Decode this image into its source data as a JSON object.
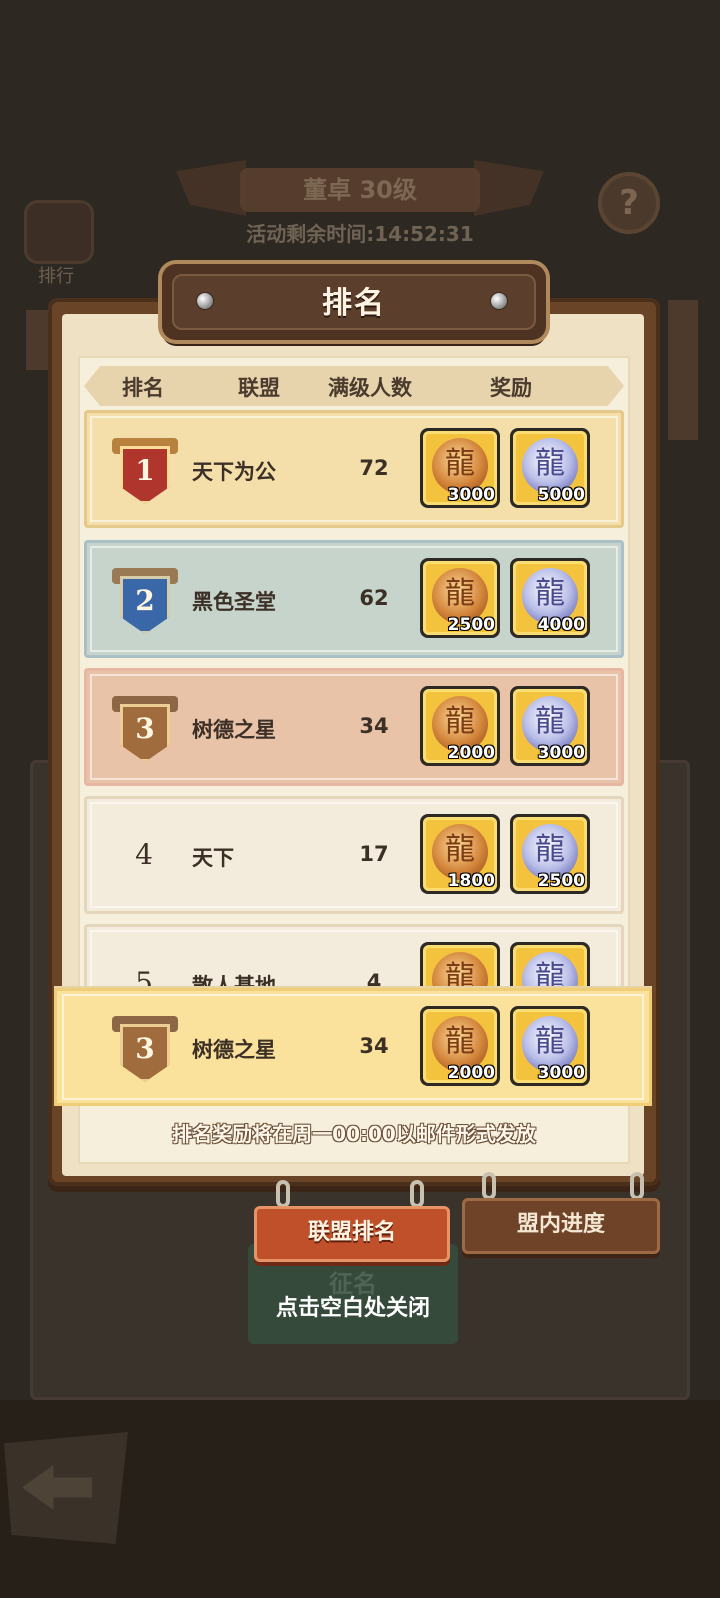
{
  "background": {
    "banner": "董卓 30级",
    "timer": "活动剩余时间:14:52:31",
    "side_label": "排行",
    "help_glyph": "?",
    "green_card_label": "征名"
  },
  "modal": {
    "title": "排名",
    "headers": {
      "rank": "排名",
      "alliance": "联盟",
      "max_level_count": "满级人数",
      "reward": "奖励"
    },
    "rows": [
      {
        "rank": "1",
        "name": "天下为公",
        "count": "72",
        "gold_reward": "3000",
        "silver_reward": "5000"
      },
      {
        "rank": "2",
        "name": "黑色圣堂",
        "count": "62",
        "gold_reward": "2500",
        "silver_reward": "4000"
      },
      {
        "rank": "3",
        "name": "树德之星",
        "count": "34",
        "gold_reward": "2000",
        "silver_reward": "3000"
      },
      {
        "rank": "4",
        "name": "天下",
        "count": "17",
        "gold_reward": "1800",
        "silver_reward": "2500"
      },
      {
        "rank": "5",
        "name": "散人基地",
        "count": "4"
      }
    ],
    "self_row": {
      "rank": "3",
      "name": "树德之星",
      "count": "34",
      "gold_reward": "2000",
      "silver_reward": "3000"
    },
    "footer_note": "排名奖励将在周一00:00以邮件形式发放"
  },
  "tabs": {
    "alliance_ranking": "联盟排名",
    "alliance_progress": "盟内进度"
  },
  "close_hint": "点击空白处关闭",
  "icons": {
    "gold_reward": "gold-dragon-coin-icon",
    "silver_reward": "silver-dragon-coin-icon"
  },
  "colors": {
    "row_1": "#f4dfaa",
    "row_2": "#c6d4cc",
    "row_3": "#e9c3a7",
    "self_row": "#fae29c",
    "active_tab": "#c0502a"
  }
}
